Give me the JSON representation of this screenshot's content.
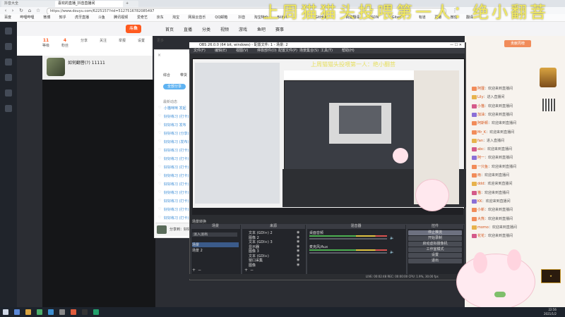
{
  "browser": {
    "tabs": [
      {
        "label": "抖音大全"
      },
      {
        "label": "喜欢的直播_抖音直播间",
        "active": true
      },
      {
        "label": ""
      }
    ],
    "url": "https://www.douyu.com/6225157?rid=5127516782085497",
    "bookmarks": [
      "百度",
      "哔哩哔哩",
      "微博",
      "知乎",
      "虎牙直播",
      "斗鱼",
      "腾讯视频",
      "爱奇艺",
      "京东",
      "淘宝",
      "网易云音乐",
      "QQ邮箱",
      "抖音",
      "淘宝特价",
      "Bilibili",
      "GitHub",
      "百度翻译",
      "CSDN",
      "Gitee",
      "有道",
      "豆瓣",
      "微信",
      "翻译"
    ]
  },
  "banner": {
    "text": "上周猫猫头投喂第一人：绝小翻菩"
  },
  "site": {
    "logo": "斗鱼",
    "nav": [
      "首页",
      "直播",
      "分类",
      "视频",
      "游戏",
      "鱼吧",
      "赛事"
    ],
    "stats": [
      {
        "value": "11",
        "label": "等级"
      },
      {
        "value": "4",
        "label": "粉丝"
      },
      {
        "value": "",
        "label": "分享"
      },
      {
        "value": "",
        "label": "关注"
      },
      {
        "value": "",
        "label": "举报"
      },
      {
        "value": "",
        "label": "设置"
      },
      {
        "value": "",
        "label": "更多"
      }
    ],
    "streamer": {
      "name": "如何翻菩(?) 11111"
    },
    "right_tab": "贡献周榜"
  },
  "popup": {
    "tabs": [
      "综合",
      "带货"
    ],
    "action": "全部分享",
    "section": "最新动态",
    "items": [
      "小猫咪咪 发起",
      "好好练习 (打卡)",
      "好好练习 发布",
      "好好练习 (分享)",
      "好好练习 (发布)",
      "好好练习 (打卡)",
      "好好练习 (打卡)",
      "好好练习 (打卡)",
      "好好练习 (打卡)",
      "好好练习 (打卡)",
      "好好练习 (打卡)",
      "好好练习 (打卡)",
      "好好练习 (打卡)",
      "好好练习 (打卡)",
      "好好练习 (打卡)"
    ],
    "comment": "分享到：好好"
  },
  "obs": {
    "title": "OBS 26.0.0 (64 bit, windows) - 配置文件: 1 - 场景: 2",
    "menu": [
      "文件(F)",
      "编辑(E)",
      "视图(V)",
      "停靠部件(D)",
      "配置文件(P)",
      "场景集合(S)",
      "工具(T)",
      "帮助(H)"
    ],
    "preview_caption": "上周猫猫头投喂第一人：绝小翻菩",
    "panels": {
      "scenes": {
        "title": "场景",
        "items": [
          "场景",
          "场景 2"
        ]
      },
      "sources": {
        "title": "来源",
        "items": [
          "文本 (GDI+) 2",
          "图像 2",
          "文本 (GDI+) 3",
          "显示器",
          "图像 3",
          "文本 (GDI+)",
          "窗口采集",
          "图像"
        ]
      },
      "mixer": {
        "title": "混音器",
        "items": [
          "桌面音频",
          "麦克风/Aux"
        ]
      },
      "transitions": {
        "title": "场景转换",
        "value": "淡入淡出"
      },
      "controls": {
        "title": "控件",
        "buttons": [
          "停止推流",
          "开始录制",
          "启动虚拟摄像机",
          "工作室模式",
          "设置",
          "退出"
        ]
      }
    },
    "status": "LIVE: 00:02:48   REC: 00:00:00   CPU: 1.9%, 30.00 fps",
    "dock_label": "直播推流"
  },
  "chat": {
    "lines": [
      {
        "name": "阿狸",
        "text": "欢迎来到直播间"
      },
      {
        "name": "Lily",
        "text": "进入直播间"
      },
      {
        "name": "小猫",
        "text": "欢迎来到直播间"
      },
      {
        "name": "加油",
        "text": "欢迎来到直播间"
      },
      {
        "name": "阿斯顿",
        "text": "欢迎来到直播间"
      },
      {
        "name": "Mr_K",
        "text": "欢迎来到直播间"
      },
      {
        "name": "fan",
        "text": "进入直播间"
      },
      {
        "name": "abc",
        "text": "欢迎来到直播间"
      },
      {
        "name": "阿一",
        "text": "欢迎来到直播间"
      },
      {
        "name": "一只鱼",
        "text": "欢迎来到直播间"
      },
      {
        "name": "雨",
        "text": "欢迎来到直播间"
      },
      {
        "name": "ddd",
        "text": "欢迎来到直播间"
      },
      {
        "name": "猫",
        "text": "欢迎来到直播间"
      },
      {
        "name": "KK",
        "text": "欢迎来到直播间"
      },
      {
        "name": "小新",
        "text": "欢迎来到直播间"
      },
      {
        "name": "大熊",
        "text": "欢迎来到直播间"
      },
      {
        "name": "momo",
        "text": "欢迎来到直播间"
      },
      {
        "name": "花花",
        "text": "欢迎来到直播间"
      }
    ]
  },
  "taskbar": {
    "time": "22:56",
    "date": "2021/1/2"
  },
  "colors": {
    "accent": "#ff5a1f",
    "banner": "#f3ea54",
    "chat_name": "#d4541a",
    "obs_bg": "#2b2d31"
  }
}
